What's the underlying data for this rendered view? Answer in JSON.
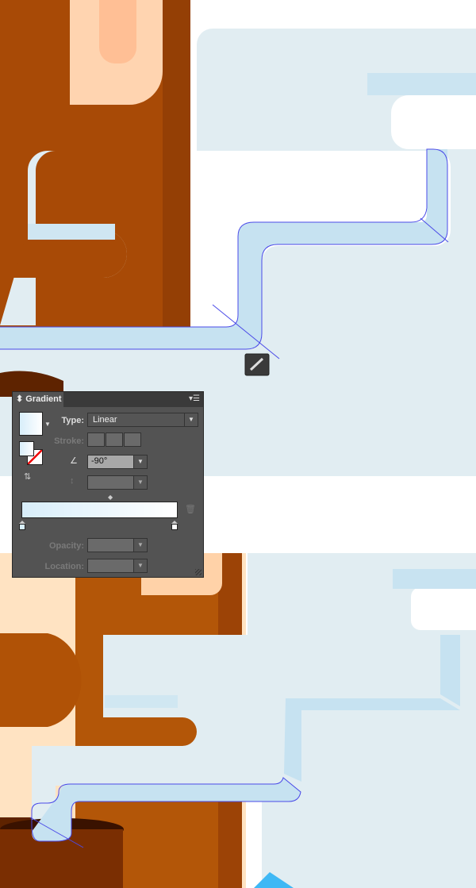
{
  "panel": {
    "title": "Gradient",
    "type_label": "Type:",
    "type_value": "Linear",
    "stroke_label": "Stroke:",
    "angle_value": "-90°",
    "opacity_label": "Opacity:",
    "location_label": "Location:",
    "gradient_start_color": "#d8eefa",
    "gradient_end_color": "#ffffff"
  },
  "colors": {
    "brown": "#a84a06",
    "dark_brown": "#5e2300",
    "peach": "#ffc9a0",
    "cloud": "#e1edf2",
    "cloud_shade": "#c4e2f1",
    "path": "#4a4ae8",
    "accent_blue": "#3fb8f5"
  },
  "icons": [
    "gradient-fill-swatch",
    "fill-stroke-swatch",
    "reverse-gradient-icon",
    "angle-icon",
    "aspect-ratio-icon",
    "midpoint-diamond",
    "delete-stop-icon",
    "gradient-tool-cursor",
    "panel-menu-icon"
  ]
}
